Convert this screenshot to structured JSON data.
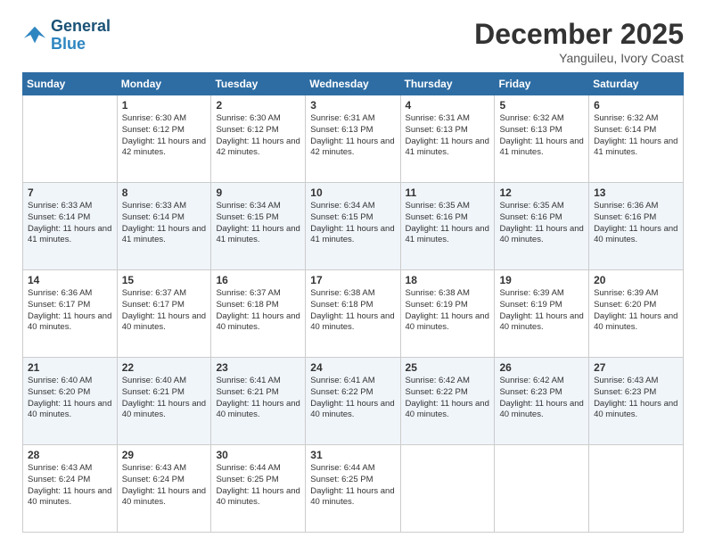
{
  "logo": {
    "line1": "General",
    "line2": "Blue"
  },
  "title": "December 2025",
  "location": "Yanguileu, Ivory Coast",
  "days_of_week": [
    "Sunday",
    "Monday",
    "Tuesday",
    "Wednesday",
    "Thursday",
    "Friday",
    "Saturday"
  ],
  "weeks": [
    [
      {
        "day": "",
        "sunrise": "",
        "sunset": "",
        "daylight": ""
      },
      {
        "day": "1",
        "sunrise": "Sunrise: 6:30 AM",
        "sunset": "Sunset: 6:12 PM",
        "daylight": "Daylight: 11 hours and 42 minutes."
      },
      {
        "day": "2",
        "sunrise": "Sunrise: 6:30 AM",
        "sunset": "Sunset: 6:12 PM",
        "daylight": "Daylight: 11 hours and 42 minutes."
      },
      {
        "day": "3",
        "sunrise": "Sunrise: 6:31 AM",
        "sunset": "Sunset: 6:13 PM",
        "daylight": "Daylight: 11 hours and 42 minutes."
      },
      {
        "day": "4",
        "sunrise": "Sunrise: 6:31 AM",
        "sunset": "Sunset: 6:13 PM",
        "daylight": "Daylight: 11 hours and 41 minutes."
      },
      {
        "day": "5",
        "sunrise": "Sunrise: 6:32 AM",
        "sunset": "Sunset: 6:13 PM",
        "daylight": "Daylight: 11 hours and 41 minutes."
      },
      {
        "day": "6",
        "sunrise": "Sunrise: 6:32 AM",
        "sunset": "Sunset: 6:14 PM",
        "daylight": "Daylight: 11 hours and 41 minutes."
      }
    ],
    [
      {
        "day": "7",
        "sunrise": "Sunrise: 6:33 AM",
        "sunset": "Sunset: 6:14 PM",
        "daylight": "Daylight: 11 hours and 41 minutes."
      },
      {
        "day": "8",
        "sunrise": "Sunrise: 6:33 AM",
        "sunset": "Sunset: 6:14 PM",
        "daylight": "Daylight: 11 hours and 41 minutes."
      },
      {
        "day": "9",
        "sunrise": "Sunrise: 6:34 AM",
        "sunset": "Sunset: 6:15 PM",
        "daylight": "Daylight: 11 hours and 41 minutes."
      },
      {
        "day": "10",
        "sunrise": "Sunrise: 6:34 AM",
        "sunset": "Sunset: 6:15 PM",
        "daylight": "Daylight: 11 hours and 41 minutes."
      },
      {
        "day": "11",
        "sunrise": "Sunrise: 6:35 AM",
        "sunset": "Sunset: 6:16 PM",
        "daylight": "Daylight: 11 hours and 41 minutes."
      },
      {
        "day": "12",
        "sunrise": "Sunrise: 6:35 AM",
        "sunset": "Sunset: 6:16 PM",
        "daylight": "Daylight: 11 hours and 40 minutes."
      },
      {
        "day": "13",
        "sunrise": "Sunrise: 6:36 AM",
        "sunset": "Sunset: 6:16 PM",
        "daylight": "Daylight: 11 hours and 40 minutes."
      }
    ],
    [
      {
        "day": "14",
        "sunrise": "Sunrise: 6:36 AM",
        "sunset": "Sunset: 6:17 PM",
        "daylight": "Daylight: 11 hours and 40 minutes."
      },
      {
        "day": "15",
        "sunrise": "Sunrise: 6:37 AM",
        "sunset": "Sunset: 6:17 PM",
        "daylight": "Daylight: 11 hours and 40 minutes."
      },
      {
        "day": "16",
        "sunrise": "Sunrise: 6:37 AM",
        "sunset": "Sunset: 6:18 PM",
        "daylight": "Daylight: 11 hours and 40 minutes."
      },
      {
        "day": "17",
        "sunrise": "Sunrise: 6:38 AM",
        "sunset": "Sunset: 6:18 PM",
        "daylight": "Daylight: 11 hours and 40 minutes."
      },
      {
        "day": "18",
        "sunrise": "Sunrise: 6:38 AM",
        "sunset": "Sunset: 6:19 PM",
        "daylight": "Daylight: 11 hours and 40 minutes."
      },
      {
        "day": "19",
        "sunrise": "Sunrise: 6:39 AM",
        "sunset": "Sunset: 6:19 PM",
        "daylight": "Daylight: 11 hours and 40 minutes."
      },
      {
        "day": "20",
        "sunrise": "Sunrise: 6:39 AM",
        "sunset": "Sunset: 6:20 PM",
        "daylight": "Daylight: 11 hours and 40 minutes."
      }
    ],
    [
      {
        "day": "21",
        "sunrise": "Sunrise: 6:40 AM",
        "sunset": "Sunset: 6:20 PM",
        "daylight": "Daylight: 11 hours and 40 minutes."
      },
      {
        "day": "22",
        "sunrise": "Sunrise: 6:40 AM",
        "sunset": "Sunset: 6:21 PM",
        "daylight": "Daylight: 11 hours and 40 minutes."
      },
      {
        "day": "23",
        "sunrise": "Sunrise: 6:41 AM",
        "sunset": "Sunset: 6:21 PM",
        "daylight": "Daylight: 11 hours and 40 minutes."
      },
      {
        "day": "24",
        "sunrise": "Sunrise: 6:41 AM",
        "sunset": "Sunset: 6:22 PM",
        "daylight": "Daylight: 11 hours and 40 minutes."
      },
      {
        "day": "25",
        "sunrise": "Sunrise: 6:42 AM",
        "sunset": "Sunset: 6:22 PM",
        "daylight": "Daylight: 11 hours and 40 minutes."
      },
      {
        "day": "26",
        "sunrise": "Sunrise: 6:42 AM",
        "sunset": "Sunset: 6:23 PM",
        "daylight": "Daylight: 11 hours and 40 minutes."
      },
      {
        "day": "27",
        "sunrise": "Sunrise: 6:43 AM",
        "sunset": "Sunset: 6:23 PM",
        "daylight": "Daylight: 11 hours and 40 minutes."
      }
    ],
    [
      {
        "day": "28",
        "sunrise": "Sunrise: 6:43 AM",
        "sunset": "Sunset: 6:24 PM",
        "daylight": "Daylight: 11 hours and 40 minutes."
      },
      {
        "day": "29",
        "sunrise": "Sunrise: 6:43 AM",
        "sunset": "Sunset: 6:24 PM",
        "daylight": "Daylight: 11 hours and 40 minutes."
      },
      {
        "day": "30",
        "sunrise": "Sunrise: 6:44 AM",
        "sunset": "Sunset: 6:25 PM",
        "daylight": "Daylight: 11 hours and 40 minutes."
      },
      {
        "day": "31",
        "sunrise": "Sunrise: 6:44 AM",
        "sunset": "Sunset: 6:25 PM",
        "daylight": "Daylight: 11 hours and 40 minutes."
      },
      {
        "day": "",
        "sunrise": "",
        "sunset": "",
        "daylight": ""
      },
      {
        "day": "",
        "sunrise": "",
        "sunset": "",
        "daylight": ""
      },
      {
        "day": "",
        "sunrise": "",
        "sunset": "",
        "daylight": ""
      }
    ]
  ]
}
